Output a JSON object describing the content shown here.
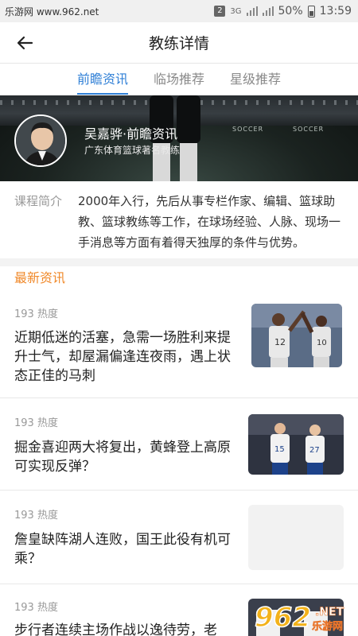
{
  "status_bar": {
    "watermark": "乐游网 www.962.net",
    "notif_count": "2",
    "network": "3G",
    "battery": "50%",
    "time": "13:59"
  },
  "header": {
    "title": "教练详情"
  },
  "tabs": [
    {
      "label": "前瞻资讯",
      "active": true
    },
    {
      "label": "临场推荐",
      "active": false
    },
    {
      "label": "星级推荐",
      "active": false
    }
  ],
  "banner": {
    "coach_name": "吴嘉骅·前瞻资讯",
    "coach_desc": "广东体育篮球著名教练",
    "ad_text": "SOCCER"
  },
  "intro": {
    "label": "课程简介",
    "text": "2000年入行，先后从事专栏作家、编辑、篮球助教、篮球教练等工作，在球场经验、人脉、现场一手消息等方面有着得天独厚的条件与优势。"
  },
  "news_section": {
    "title": "最新资讯",
    "items": [
      {
        "heat": "193 热度",
        "title": "近期低迷的活塞，急需一场胜利来提升士气，却屋漏偏逢连夜雨，遇上状态正佳的马刺",
        "image": "spurs-players-photo"
      },
      {
        "heat": "193 热度",
        "title": "掘金喜迎两大将复出，黄蜂登上高原可实现反弹？",
        "image": "nuggets-players-photo"
      },
      {
        "heat": "193 热度",
        "title": "詹皇缺阵湖人连败，国王此役有机可乘？",
        "image": "placeholder"
      },
      {
        "heat": "193 热度",
        "title": "步行者连续主场作战以逸待劳，老",
        "image": "nuggets-players-photo"
      }
    ]
  },
  "watermark_logo": "962 乐游网 .NET",
  "colors": {
    "accent_blue": "#2f7fd6",
    "accent_orange": "#f0892a"
  }
}
